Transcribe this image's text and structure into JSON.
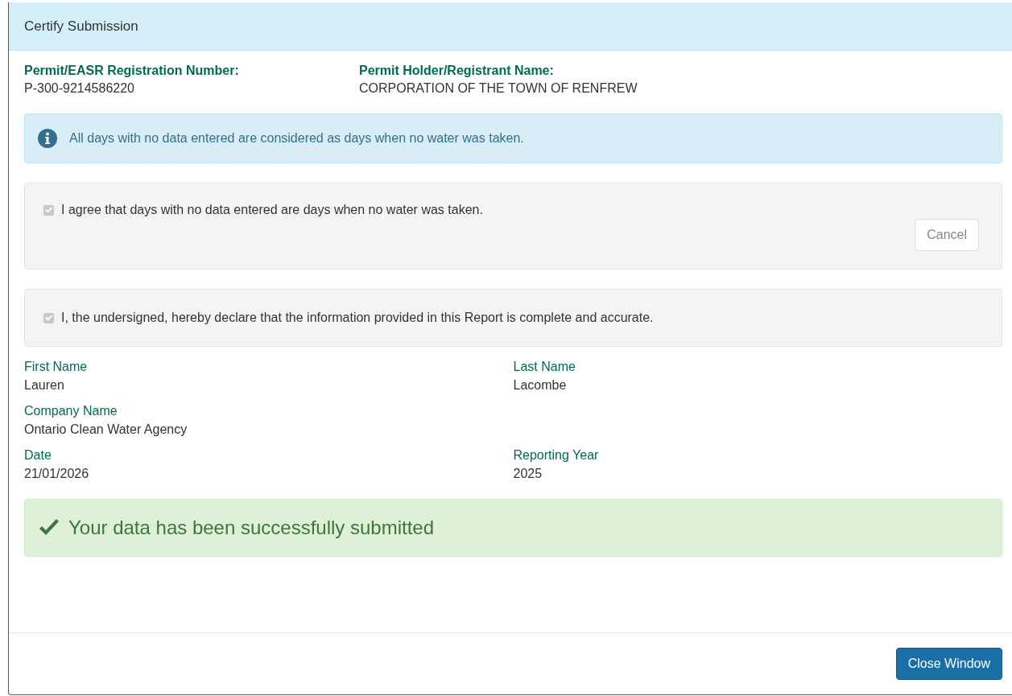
{
  "dialog": {
    "title": "Certify Submission"
  },
  "permit": [
    {
      "label": "Permit/EASR Registration Number:",
      "value": "P-300-9214586220"
    },
    {
      "label": "Permit Holder/Registrant Name:",
      "value": "CORPORATION OF THE TOWN OF RENFREW"
    }
  ],
  "info_alert": {
    "text": "All days with no data entered are considered as days when no water was taken."
  },
  "agreements": [
    {
      "text": "I agree that days with no data entered are days when no water was taken.",
      "checked": true,
      "disabled": true,
      "button": "Cancel"
    },
    {
      "text": "I, the undersigned, hereby declare that the information provided in this Report is complete and accurate.",
      "checked": true,
      "disabled": true
    }
  ],
  "fields": [
    [
      {
        "label": "First Name",
        "value": "Lauren"
      },
      {
        "label": "Last Name",
        "value": "Lacombe"
      }
    ],
    [
      {
        "label": "Company Name",
        "value": "Ontario Clean Water Agency"
      }
    ],
    [
      {
        "label": "Date",
        "value": "21/01/2026"
      },
      {
        "label": "Reporting Year",
        "value": "2025"
      }
    ]
  ],
  "success_alert": {
    "text": "Your data has been successfully submitted"
  },
  "footer": {
    "button": "Close Window"
  }
}
